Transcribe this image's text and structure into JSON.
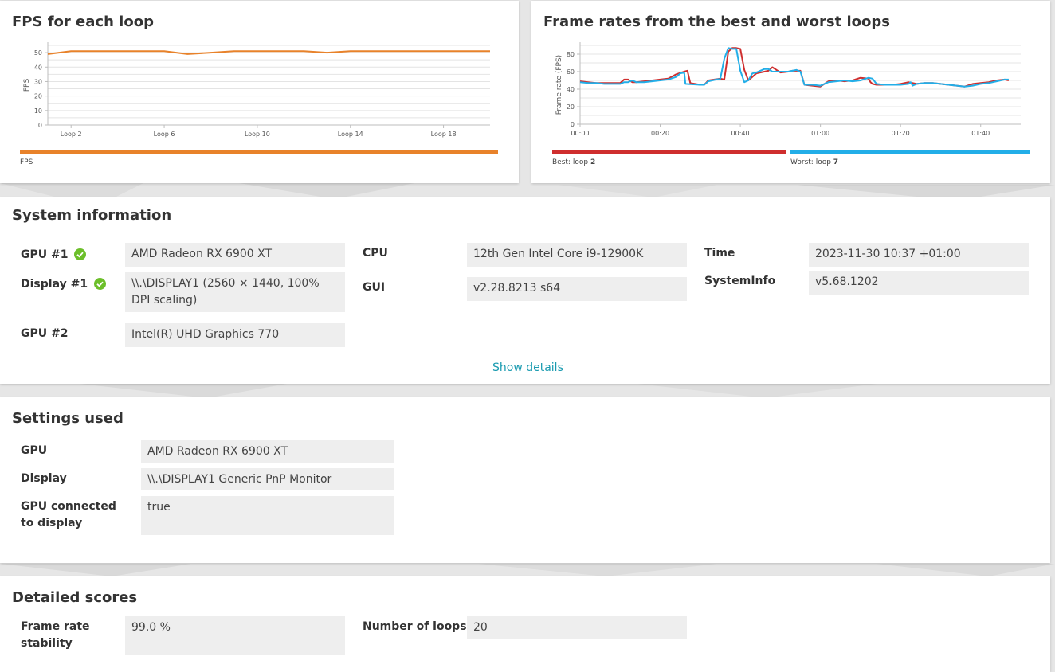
{
  "colors": {
    "fps_line": "#e8822a",
    "best_line": "#cf2e2e",
    "worst_line": "#22aee8",
    "ok_green": "#6cbf2a",
    "link": "#1a9bb0"
  },
  "fps_panel": {
    "title": "FPS for each loop",
    "legend_label": "FPS"
  },
  "best_worst_panel": {
    "title": "Frame rates from the best and worst loops",
    "best_prefix": "Best: loop",
    "best_loop": "2",
    "worst_prefix": "Worst: loop",
    "worst_loop": "7"
  },
  "chart_data": [
    {
      "type": "line",
      "title": "FPS for each loop",
      "ylabel": "FPS",
      "xlabel": "",
      "ylim": [
        0,
        55
      ],
      "yticks": [
        "0",
        "10",
        "20",
        "30",
        "40",
        "50"
      ],
      "ytick_values": [
        0,
        10,
        20,
        30,
        40,
        50
      ],
      "xtick_labels": [
        "Loop 2",
        "Loop 6",
        "Loop 10",
        "Loop 14",
        "Loop 18"
      ],
      "xtick_values": [
        2,
        6,
        10,
        14,
        18
      ],
      "xlim": [
        1,
        20
      ],
      "grid": true,
      "legend": "bottom",
      "series": [
        {
          "name": "FPS",
          "x": [
            1,
            2,
            3,
            4,
            5,
            6,
            7,
            8,
            9,
            10,
            11,
            12,
            13,
            14,
            15,
            16,
            17,
            18,
            19,
            20
          ],
          "values": [
            49,
            51,
            51,
            51,
            51,
            51,
            49,
            50,
            51,
            51,
            51,
            51,
            50,
            51,
            51,
            51,
            51,
            51,
            51,
            51
          ]
        }
      ]
    },
    {
      "type": "line",
      "title": "Frame rates from the best and worst loops",
      "ylabel": "Frame rate (FPS)",
      "xlabel": "",
      "ylim": [
        0,
        90
      ],
      "yticks": [
        "0",
        "20",
        "40",
        "60",
        "80"
      ],
      "ytick_values": [
        0,
        20,
        40,
        60,
        80
      ],
      "xtick_labels": [
        "00:00",
        "00:20",
        "00:40",
        "01:00",
        "01:20",
        "01:40"
      ],
      "xtick_values": [
        0,
        20,
        40,
        60,
        80,
        100
      ],
      "xlim": [
        0,
        110
      ],
      "grid": true,
      "legend": "bottom",
      "series": [
        {
          "name": "Best: loop 2",
          "x": [
            0,
            2,
            4,
            6,
            8,
            10,
            11,
            12,
            13,
            14,
            16,
            18,
            20,
            22,
            24,
            26,
            26.8,
            27.5,
            30,
            31,
            32,
            35,
            36,
            37,
            38,
            39,
            40,
            41,
            42,
            44,
            46,
            47,
            48,
            50,
            52,
            53,
            54,
            55,
            56,
            60,
            62,
            64,
            66,
            68,
            70,
            72,
            72.5,
            73,
            74,
            76,
            78,
            80,
            82,
            84,
            86,
            88,
            90,
            92,
            94,
            96,
            98,
            100,
            102,
            104,
            106,
            107
          ],
          "values": [
            49,
            48,
            47,
            47,
            47,
            47,
            51,
            51,
            48,
            48,
            49,
            50,
            51,
            52,
            57,
            60,
            61,
            47,
            45,
            45,
            50,
            52,
            51,
            83,
            87,
            87,
            86,
            62,
            50,
            58,
            60,
            61,
            65,
            59,
            60,
            61,
            61,
            61,
            45,
            43,
            49,
            50,
            49,
            50,
            53,
            52,
            48,
            46,
            45,
            45,
            45,
            46,
            48,
            46,
            47,
            47,
            46,
            45,
            44,
            43,
            46,
            47,
            48,
            50,
            51,
            50
          ]
        },
        {
          "name": "Worst: loop 7",
          "x": [
            0,
            2,
            4,
            6,
            8,
            10,
            11,
            12,
            13,
            14,
            16,
            18,
            20,
            22,
            24,
            25,
            26,
            26.3,
            30,
            31,
            32,
            34,
            35,
            36,
            37,
            38,
            39,
            40,
            41,
            42,
            43,
            44,
            46,
            47,
            48,
            50,
            52,
            53,
            54,
            55,
            56,
            58,
            60,
            62,
            64,
            66,
            68,
            70,
            72,
            73,
            74,
            76,
            78,
            80,
            82,
            82.5,
            83,
            84,
            86,
            88,
            90,
            92,
            94,
            96,
            98,
            100,
            102,
            104,
            106,
            107
          ],
          "values": [
            48,
            47,
            47,
            46,
            46,
            46,
            48,
            48,
            50,
            48,
            48,
            49,
            50,
            51,
            54,
            58,
            59,
            46,
            45,
            45,
            49,
            51,
            52,
            75,
            87,
            86,
            86,
            61,
            48,
            50,
            58,
            59,
            63,
            63,
            60,
            60,
            60,
            61,
            62,
            60,
            45,
            45,
            44,
            48,
            49,
            50,
            49,
            50,
            53,
            52,
            46,
            45,
            45,
            45,
            46,
            48,
            44,
            46,
            47,
            47,
            46,
            45,
            44,
            43,
            44,
            46,
            47,
            49,
            51,
            51
          ]
        }
      ]
    }
  ],
  "system_info": {
    "title": "System information",
    "gpu1_label": "GPU #1",
    "gpu1_value": "AMD Radeon RX 6900 XT",
    "display1_label": "Display #1",
    "display1_value": "\\\\.\\DISPLAY1 (2560 × 1440, 100% DPI scaling)",
    "gpu2_label": "GPU #2",
    "gpu2_value": "Intel(R) UHD Graphics 770",
    "cpu_label": "CPU",
    "cpu_value": "12th Gen Intel Core i9-12900K",
    "gui_label": "GUI",
    "gui_value": "v2.28.8213 s64",
    "time_label": "Time",
    "time_value": "2023-11-30 10:37 +01:00",
    "sysinfo_label": "SystemInfo",
    "sysinfo_value": "v5.68.1202",
    "show_details": "Show details"
  },
  "settings_used": {
    "title": "Settings used",
    "gpu_label": "GPU",
    "gpu_value": "AMD Radeon RX 6900 XT",
    "display_label": "Display",
    "display_value": "\\\\.\\DISPLAY1 Generic PnP Monitor",
    "connected_label": "GPU connected to display",
    "connected_value": "true"
  },
  "detailed_scores": {
    "title": "Detailed scores",
    "stability_label": "Frame rate stability",
    "stability_value": "99.0 %",
    "loops_label": "Number of loops",
    "loops_value": "20"
  }
}
